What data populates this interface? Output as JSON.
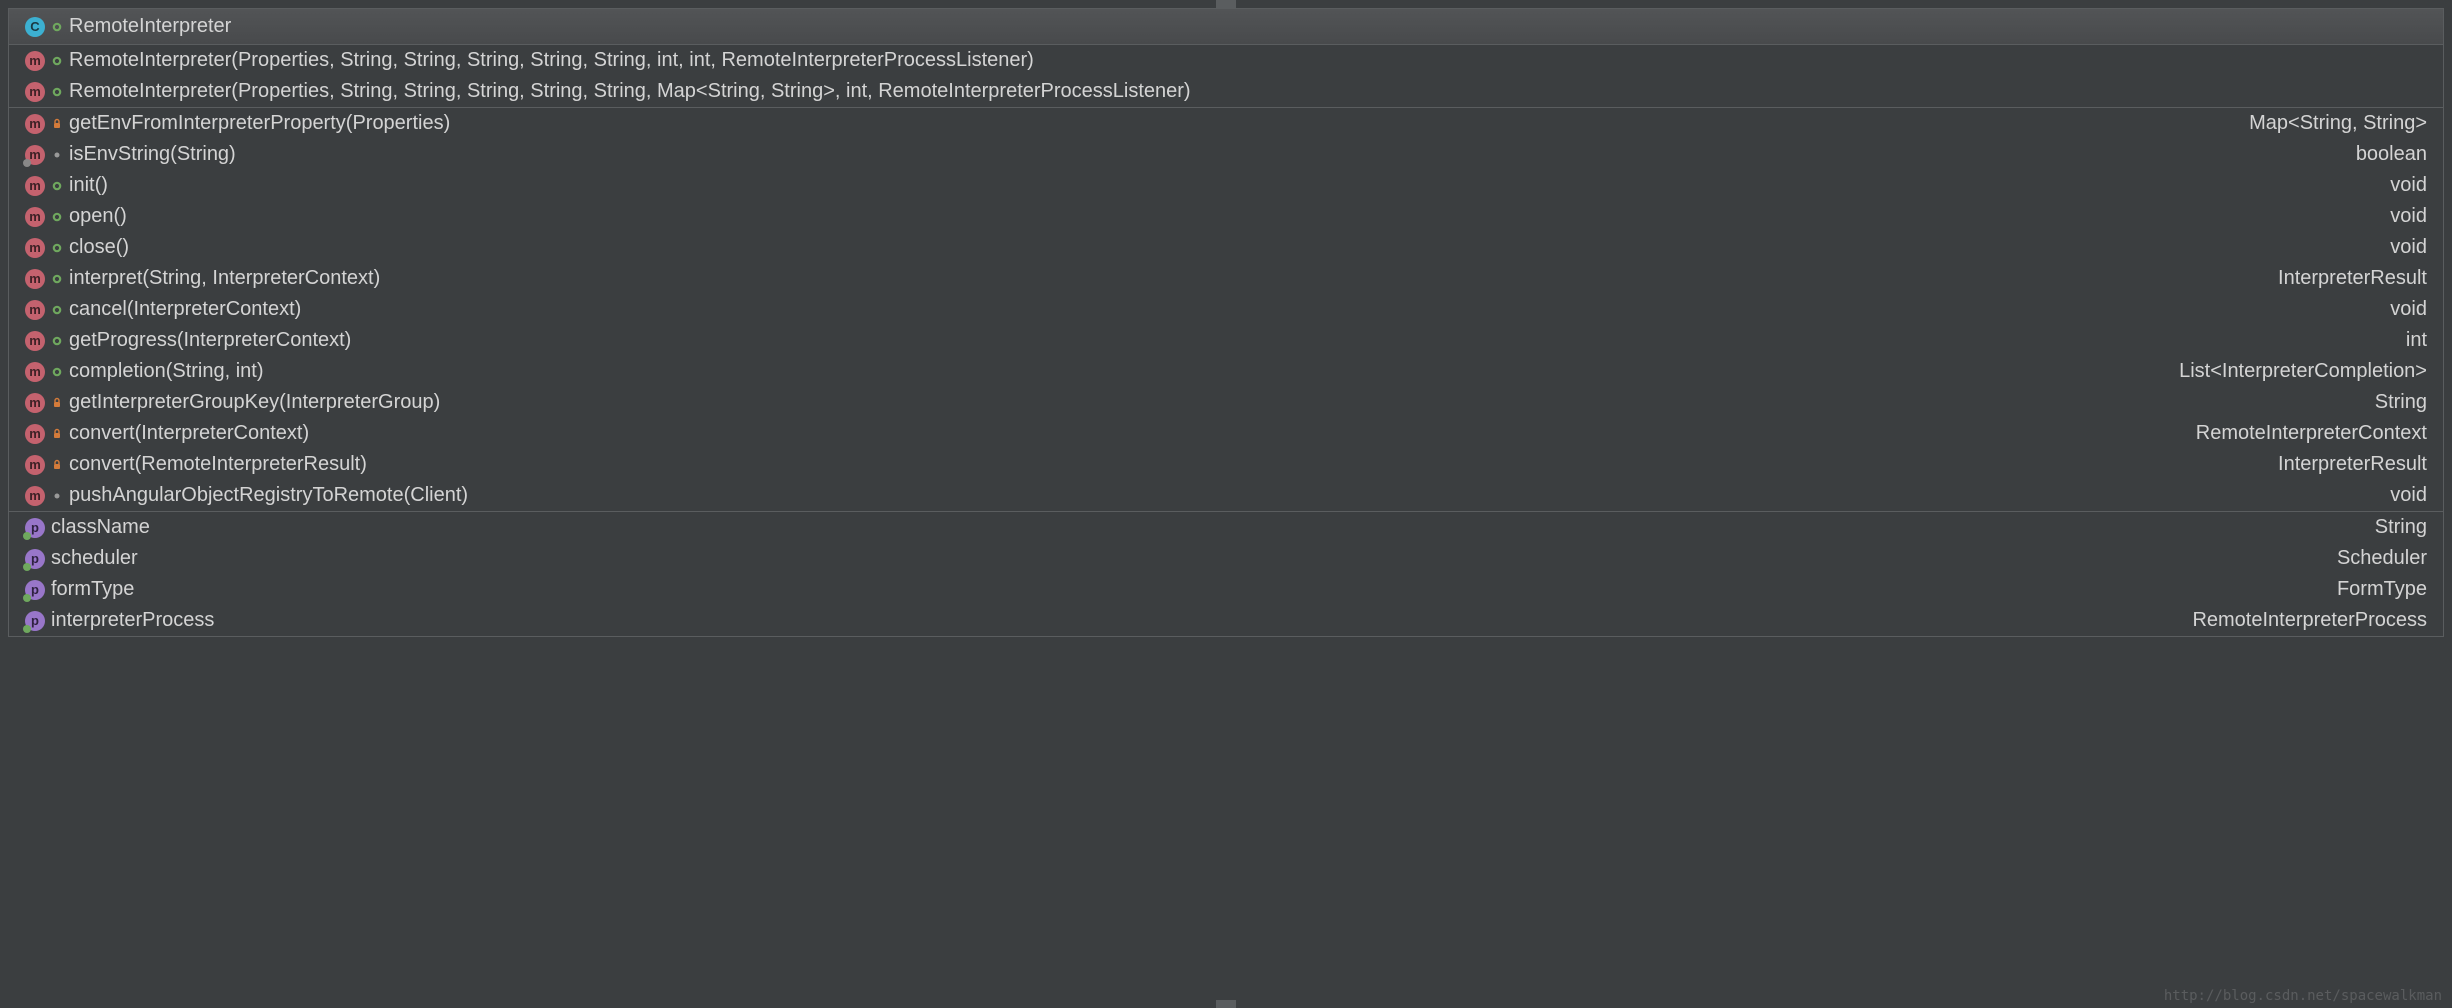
{
  "className": "RemoteInterpreter",
  "constructors": [
    {
      "signature": "RemoteInterpreter(Properties, String, String, String, String, String, int, int, RemoteInterpreterProcessListener)"
    },
    {
      "signature": "RemoteInterpreter(Properties, String, String, String, String, String, Map<String, String>, int, RemoteInterpreterProcessListener)"
    }
  ],
  "methods": [
    {
      "name": "getEnvFromInterpreterProperty(Properties)",
      "returnType": "Map<String, String>",
      "access": "private",
      "kind": "m"
    },
    {
      "name": "isEnvString(String)",
      "returnType": "boolean",
      "access": "package",
      "kind": "m",
      "inherited": true
    },
    {
      "name": "init()",
      "returnType": "void",
      "access": "public",
      "kind": "m"
    },
    {
      "name": "open()",
      "returnType": "void",
      "access": "public",
      "kind": "m"
    },
    {
      "name": "close()",
      "returnType": "void",
      "access": "public",
      "kind": "m"
    },
    {
      "name": "interpret(String, InterpreterContext)",
      "returnType": "InterpreterResult",
      "access": "public",
      "kind": "m"
    },
    {
      "name": "cancel(InterpreterContext)",
      "returnType": "void",
      "access": "public",
      "kind": "m"
    },
    {
      "name": "getProgress(InterpreterContext)",
      "returnType": "int",
      "access": "public",
      "kind": "m"
    },
    {
      "name": "completion(String, int)",
      "returnType": "List<InterpreterCompletion>",
      "access": "public",
      "kind": "m"
    },
    {
      "name": "getInterpreterGroupKey(InterpreterGroup)",
      "returnType": "String",
      "access": "private",
      "kind": "m"
    },
    {
      "name": "convert(InterpreterContext)",
      "returnType": "RemoteInterpreterContext",
      "access": "private",
      "kind": "m"
    },
    {
      "name": "convert(RemoteInterpreterResult)",
      "returnType": "InterpreterResult",
      "access": "private",
      "kind": "m"
    },
    {
      "name": "pushAngularObjectRegistryToRemote(Client)",
      "returnType": "void",
      "access": "package",
      "kind": "m"
    }
  ],
  "properties": [
    {
      "name": "className",
      "returnType": "String"
    },
    {
      "name": "scheduler",
      "returnType": "Scheduler"
    },
    {
      "name": "formType",
      "returnType": "FormType"
    },
    {
      "name": "interpreterProcess",
      "returnType": "RemoteInterpreterProcess"
    }
  ],
  "watermark": "http://blog.csdn.net/spacewalkman"
}
